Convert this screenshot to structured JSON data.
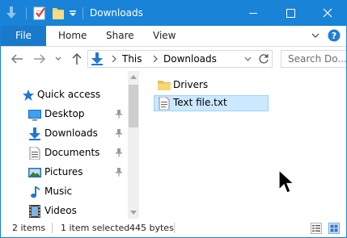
{
  "window": {
    "title": "Downloads"
  },
  "ribbon": {
    "file_tab": "File",
    "tabs": [
      "Home",
      "Share",
      "View"
    ]
  },
  "address": {
    "crumbs": [
      "This",
      "Downloads"
    ]
  },
  "search": {
    "placeholder": "Search Do..."
  },
  "nav": {
    "quick_access": "Quick access",
    "items": [
      {
        "label": "Desktop",
        "pinned": true,
        "icon": "desktop-icon"
      },
      {
        "label": "Downloads",
        "pinned": true,
        "icon": "download-arrow-icon"
      },
      {
        "label": "Documents",
        "pinned": true,
        "icon": "document-icon"
      },
      {
        "label": "Pictures",
        "pinned": true,
        "icon": "pictures-icon"
      },
      {
        "label": "Music",
        "pinned": false,
        "icon": "music-note-icon"
      },
      {
        "label": "Videos",
        "pinned": false,
        "icon": "film-icon"
      }
    ]
  },
  "files": [
    {
      "name": "Drivers",
      "type": "folder",
      "selected": false
    },
    {
      "name": "Text file.txt",
      "type": "text",
      "selected": true
    }
  ],
  "status": {
    "count": "2 items",
    "selected": "1 item selected",
    "size": "445 bytes"
  },
  "colors": {
    "accent": "#1883d7",
    "file_tab": "#1979ca",
    "selection": "#cce8ff",
    "selection_border": "#99d1ff"
  }
}
